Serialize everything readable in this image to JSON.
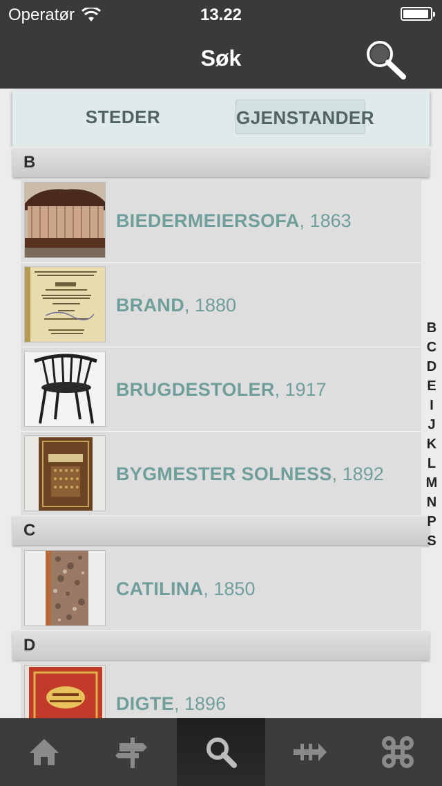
{
  "status": {
    "carrier": "Operatør",
    "time": "13.22",
    "battery_level": 0.95
  },
  "nav": {
    "title": "Søk",
    "search_icon": "search-icon"
  },
  "segments": {
    "steder": "STEDER",
    "gjenstander": "GJENSTANDER",
    "selected": "gjenstander"
  },
  "sections": [
    {
      "letter": "B",
      "items": [
        {
          "name": "BIEDERMEIERSOFA",
          "year": ", 1863"
        },
        {
          "name": "BRAND",
          "year": ", 1880"
        },
        {
          "name": "BRUGDESTOLER",
          "year": ", 1917"
        },
        {
          "name": "BYGMESTER SOLNESS",
          "year": ", 1892"
        }
      ]
    },
    {
      "letter": "C",
      "items": [
        {
          "name": "CATILINA",
          "year": ", 1850"
        }
      ]
    },
    {
      "letter": "D",
      "items": [
        {
          "name": "DIGTE",
          "year": ", 1896"
        }
      ]
    }
  ],
  "index": [
    "B",
    "C",
    "D",
    "E",
    "I",
    "J",
    "K",
    "L",
    "M",
    "N",
    "P",
    "S"
  ],
  "tabs": [
    "home-icon",
    "signpost-icon",
    "search-icon",
    "timeline-icon",
    "command-icon"
  ],
  "active_tab": "search-icon",
  "colors": {
    "bar": "#3a3a3a",
    "accent": "#6f9e9b",
    "segment_bg": "#e0eaea"
  }
}
